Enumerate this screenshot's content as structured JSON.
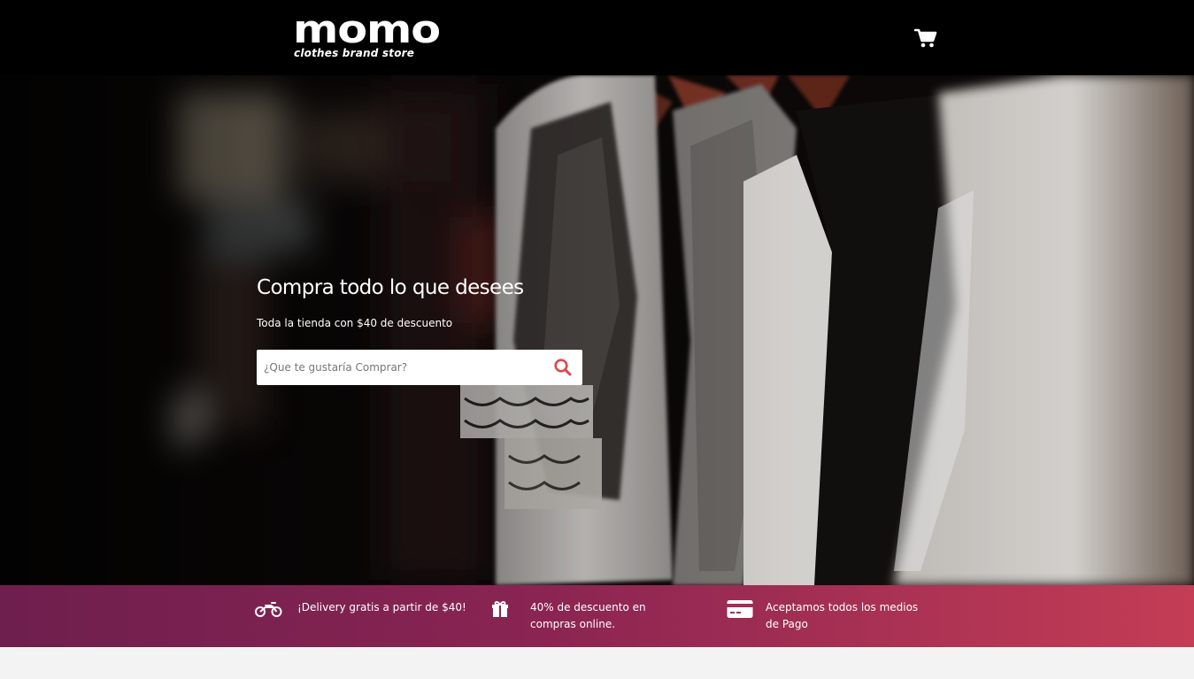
{
  "header": {
    "logo_title": "momo",
    "logo_subtitle": "clothes brand store",
    "cart_icon": "shopping-cart-icon"
  },
  "hero": {
    "title": "Compra todo lo que desees",
    "subtitle": "Toda la tienda con $40 de descuento",
    "search": {
      "placeholder": "¿Que te gustaría Comprar?",
      "value": "",
      "icon": "search-icon"
    }
  },
  "benefits": [
    {
      "icon": "motorcycle-icon",
      "text": "¡Delivery gratis a partir de $40!"
    },
    {
      "icon": "gift-icon",
      "text": "40% de descuento en compras online."
    },
    {
      "icon": "credit-card-icon",
      "text": "Aceptamos todos los medios de Pago"
    }
  ],
  "colors": {
    "header_bg": "#000000",
    "accent": "#e0474c",
    "strip_gradient_start": "#6e1f4e",
    "strip_gradient_end": "#c43d55",
    "page_bg": "#f4f3f4"
  }
}
